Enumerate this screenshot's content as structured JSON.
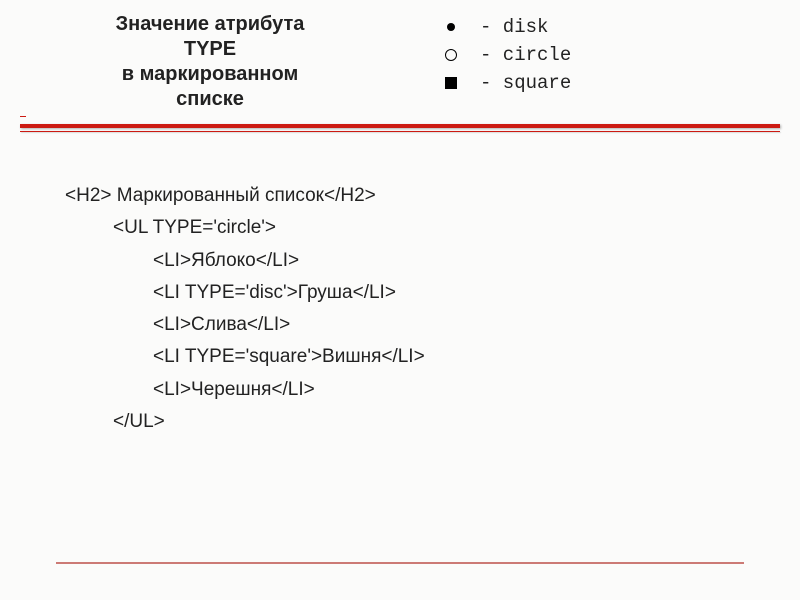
{
  "title": {
    "line1": "Значение атрибута",
    "line2": "TYPE",
    "line3": "в маркированном",
    "line4": "списке"
  },
  "legend": {
    "disk": "- disk",
    "circle": "- circle",
    "square": "- square"
  },
  "code": {
    "h2": "<H2> Маркированный список</H2>",
    "ul_open": "<UL TYPE='circle'>",
    "li1": "<LI>Яблоко</LI>",
    "li2": "<LI TYPE='disc'>Груша</LI>",
    "li3": "<LI>Слива</LI>",
    "li4": "<LI TYPE='square'>Вишня</LI>",
    "li5": "<LI>Черешня</LI>",
    "ul_close": "</UL>"
  },
  "colors": {
    "accent": "#cc1a12"
  }
}
